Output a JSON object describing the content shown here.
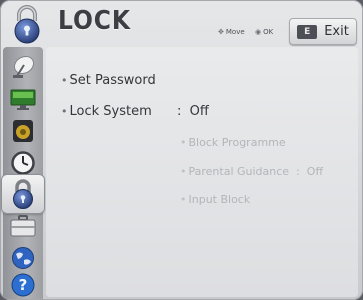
{
  "header": {
    "title": "LOCK",
    "hints": {
      "move_glyph": "✥",
      "move_label": "Move",
      "ok_glyph": "◉",
      "ok_label": "OK"
    },
    "exit_button": {
      "key_label": "E",
      "label": "Exit"
    }
  },
  "sidebar": {
    "items": [
      {
        "icon": "satellite-dish-icon",
        "active": false
      },
      {
        "icon": "tv-screen-icon",
        "active": false
      },
      {
        "icon": "speaker-icon",
        "active": false
      },
      {
        "icon": "clock-icon",
        "active": false
      },
      {
        "icon": "lock-icon",
        "active": true
      },
      {
        "icon": "briefcase-icon",
        "active": false
      },
      {
        "icon": "globe-icon",
        "active": false
      },
      {
        "icon": "help-icon",
        "active": false
      }
    ]
  },
  "menu": {
    "bullet": "•",
    "items": [
      {
        "label": "Set Password",
        "value": "",
        "enabled": true
      },
      {
        "label": "Lock System",
        "separator": ":",
        "value": "Off",
        "enabled": true
      },
      {
        "label": "Block Programme",
        "value": "",
        "enabled": false
      },
      {
        "label": "Parental Guidance",
        "separator": ":",
        "value": "Off",
        "enabled": false
      },
      {
        "label": "Input Block",
        "value": "",
        "enabled": false
      }
    ]
  },
  "colors": {
    "accent": "#3a5fa8",
    "text": "#34363b",
    "disabled_text": "#b3b5b9"
  }
}
